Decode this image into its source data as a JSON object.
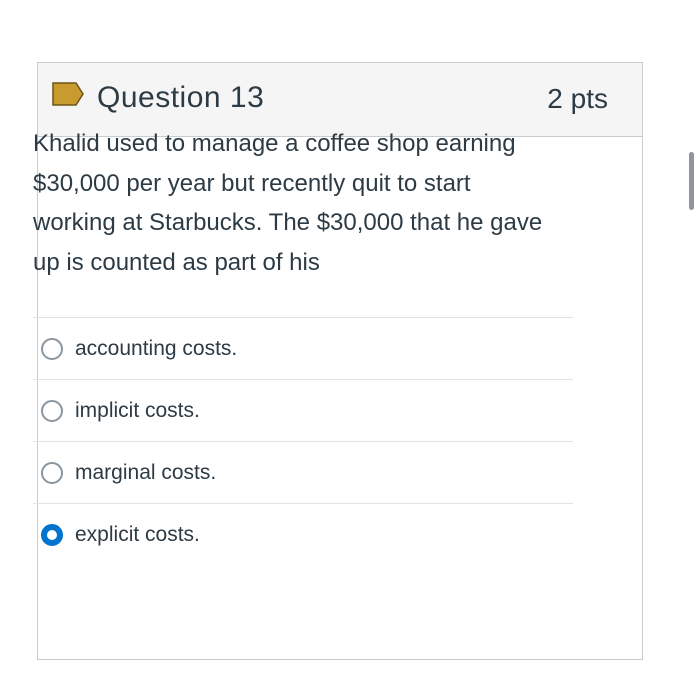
{
  "question": {
    "title": "Question 13",
    "points": "2 pts",
    "flag_color": "#c99a2e",
    "text": "Khalid used to manage a coffee shop earning $30,000 per year but recently quit to start working at Starbucks.  The $30,000 that he gave up is counted as part of his"
  },
  "answers": [
    {
      "label": "accounting costs.",
      "selected": false
    },
    {
      "label": "implicit costs.",
      "selected": false
    },
    {
      "label": "marginal costs.",
      "selected": false
    },
    {
      "label": "explicit costs.",
      "selected": true
    }
  ],
  "accent_color": "#0374ce"
}
